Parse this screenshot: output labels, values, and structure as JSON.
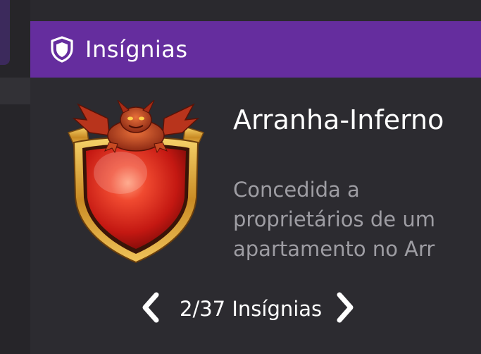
{
  "header": {
    "title": "Insígnias",
    "icon": "shield-icon"
  },
  "badge": {
    "name": "Arranha-Inferno",
    "description": "Concedida a proprietários de um apartamento no Arr",
    "image_icon": "gargoyle-shield-badge"
  },
  "pager": {
    "label": "2/37 Insígnias",
    "prev_icon": "chevron-left-icon",
    "next_icon": "chevron-right-icon"
  },
  "colors": {
    "header_bg": "#652d9e",
    "panel_bg": "#2c2b30",
    "text_primary": "#ffffff",
    "text_secondary": "#9e9da3",
    "badge_red": "#d8261c",
    "badge_gold": "#e0a53a"
  }
}
